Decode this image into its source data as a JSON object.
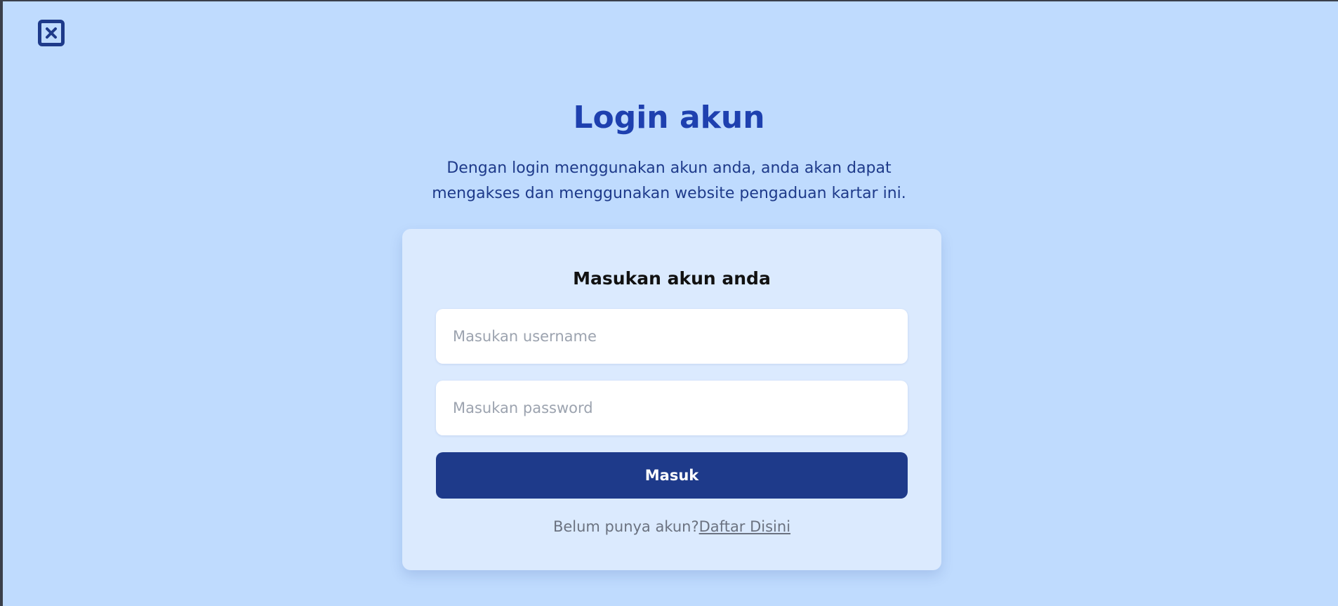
{
  "page": {
    "close_icon": "close-square-icon",
    "title": "Login akun",
    "subtitle_line1": "Dengan login menggunakan akun anda, anda akan dapat",
    "subtitle_line2": "mengakses dan menggunakan website pengaduan kartar ini."
  },
  "card": {
    "title": "Masukan akun anda",
    "username_placeholder": "Masukan username",
    "username_value": "",
    "password_placeholder": "Masukan password",
    "password_value": "",
    "submit_label": "Masuk",
    "register_prompt": "Belum punya akun?",
    "register_link": "Daftar Disini"
  },
  "colors": {
    "background": "#bfdbfe",
    "card": "#dbeafe",
    "primary": "#1e3a8a",
    "title": "#1e40af"
  }
}
